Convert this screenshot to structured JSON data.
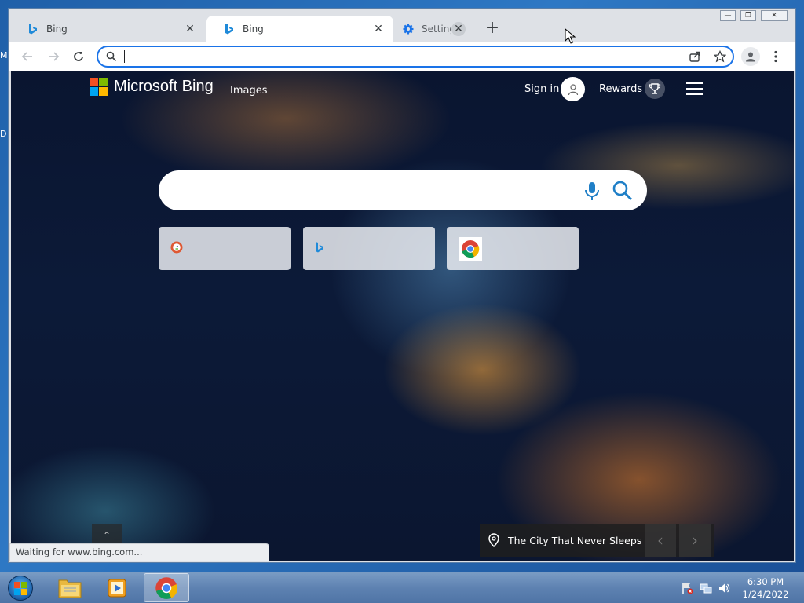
{
  "desktop": {
    "edge_letters": [
      "M",
      "D"
    ]
  },
  "browser": {
    "tabs": [
      {
        "title": "Bing",
        "active": false,
        "icon": "bing-favicon"
      },
      {
        "title": "Bing",
        "active": true,
        "icon": "bing-favicon"
      },
      {
        "title": "Settings",
        "active": false,
        "icon": "gear-icon"
      }
    ],
    "new_tab_label": "+",
    "window_controls": {
      "minimize": "—",
      "restore": "❐",
      "close": "✕"
    },
    "address_bar": {
      "value": "",
      "placeholder": ""
    },
    "status_text": "Waiting for www.bing.com..."
  },
  "bing": {
    "brand": "Microsoft Bing",
    "nav_images": "Images",
    "sign_in": "Sign in",
    "rewards": "Rewards",
    "search": {
      "value": "",
      "placeholder": ""
    },
    "quick_links": [
      {
        "icon": "duckduckgo-icon"
      },
      {
        "icon": "bing-favicon"
      },
      {
        "icon": "chrome-icon"
      }
    ],
    "image_caption": "The City That Never Sleeps",
    "caption_prev": "‹",
    "caption_next": "›",
    "scroll_up": "⌃"
  },
  "taskbar": {
    "apps": [
      "file-explorer",
      "media-player",
      "chrome"
    ],
    "clock_time": "6:30 PM",
    "clock_date": "1/24/2022"
  },
  "colors": {
    "ms_red": "#f25022",
    "ms_green": "#7fba00",
    "ms_blue": "#00a4ef",
    "ms_yellow": "#ffb900",
    "focus_blue": "#1a73e8",
    "bing_icon_blue": "#1f8ad9"
  }
}
